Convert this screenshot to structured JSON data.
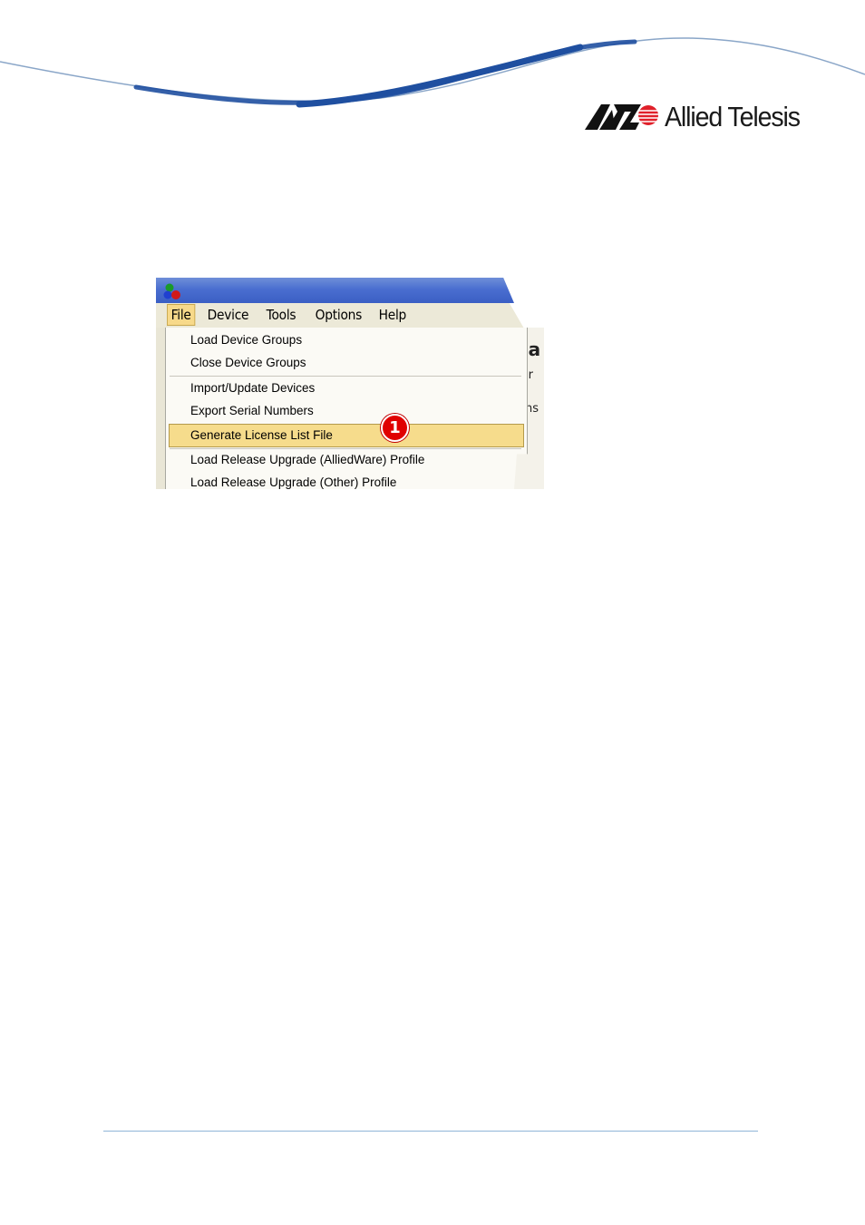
{
  "header": {
    "logo_text": "Allied Telesis",
    "logo_mark_icon": "allied-telesis-logo-mark",
    "accent_color": "#1f4fa0"
  },
  "screenshot": {
    "menubar": {
      "items": [
        {
          "label": "File",
          "active": true
        },
        {
          "label": "Device"
        },
        {
          "label": "Tools"
        },
        {
          "label": "Options"
        },
        {
          "label": "Help"
        }
      ]
    },
    "file_menu": {
      "items": [
        {
          "label": "Load Device Groups"
        },
        {
          "label": "Close Device Groups"
        },
        {
          "label": "Import/Update Devices"
        },
        {
          "label": "Export Serial Numbers"
        },
        {
          "label": "Generate License List File",
          "highlighted": true
        },
        {
          "label": "Load Release Upgrade (AlliedWare) Profile"
        },
        {
          "label": "Load Release Upgrade (Other) Profile"
        }
      ],
      "callout_number": "1"
    },
    "background_fragments": [
      "ea",
      "var",
      "ens"
    ],
    "highlight_color": "#f6dc8c",
    "callout_color": "#e00000"
  }
}
